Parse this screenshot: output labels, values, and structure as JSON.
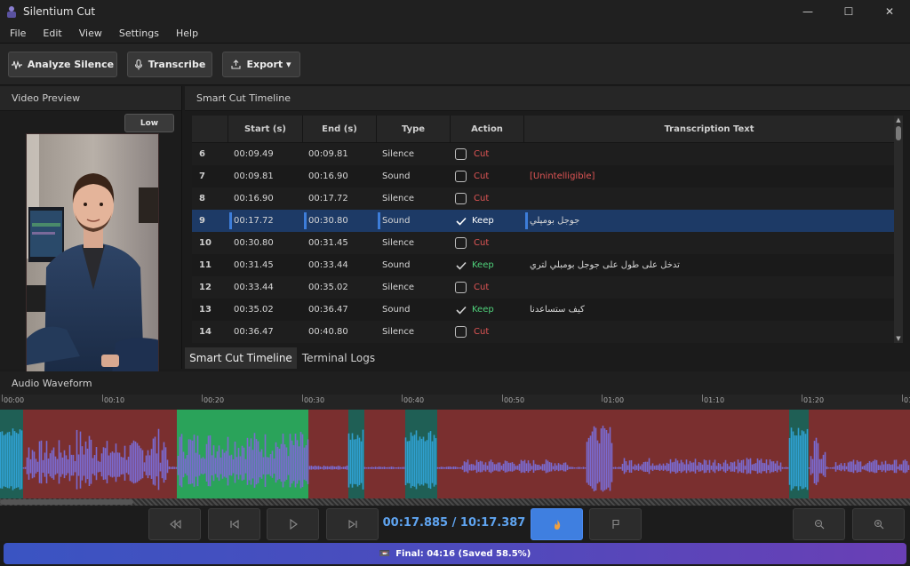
{
  "window": {
    "title": "Silentium Cut",
    "minimize_glyph": "—",
    "maximize_glyph": "☐",
    "close_glyph": "✕"
  },
  "menu": [
    "File",
    "Edit",
    "View",
    "Settings",
    "Help"
  ],
  "toolbar": {
    "analyze_label": "Analyze Silence",
    "transcribe_label": "Transcribe",
    "export_label": "Export ▾"
  },
  "video_preview": {
    "header": "Video Preview",
    "quality": "Low"
  },
  "timeline": {
    "header": "Smart Cut Timeline",
    "columns": [
      "Start (s)",
      "End (s)",
      "Type",
      "Action",
      "Transcription Text"
    ],
    "rows": [
      {
        "idx": "6",
        "start": "00:09.49",
        "end": "00:09.81",
        "type": "Silence",
        "action": "Cut",
        "checked": false,
        "text": "",
        "text_red": false,
        "selected": false
      },
      {
        "idx": "7",
        "start": "00:09.81",
        "end": "00:16.90",
        "type": "Sound",
        "action": "Cut",
        "checked": false,
        "text": "[Unintelligible]",
        "text_red": true,
        "selected": false
      },
      {
        "idx": "8",
        "start": "00:16.90",
        "end": "00:17.72",
        "type": "Silence",
        "action": "Cut",
        "checked": false,
        "text": "",
        "text_red": false,
        "selected": false
      },
      {
        "idx": "9",
        "start": "00:17.72",
        "end": "00:30.80",
        "type": "Sound",
        "action": "Keep",
        "checked": true,
        "text": "جوجل بومپلي",
        "text_red": false,
        "selected": true
      },
      {
        "idx": "10",
        "start": "00:30.80",
        "end": "00:31.45",
        "type": "Silence",
        "action": "Cut",
        "checked": false,
        "text": "",
        "text_red": false,
        "selected": false
      },
      {
        "idx": "11",
        "start": "00:31.45",
        "end": "00:33.44",
        "type": "Sound",
        "action": "Keep",
        "checked": true,
        "text": "تدخل على طول على جوجل بومبلي لتري",
        "text_red": false,
        "selected": false
      },
      {
        "idx": "12",
        "start": "00:33.44",
        "end": "00:35.02",
        "type": "Silence",
        "action": "Cut",
        "checked": false,
        "text": "",
        "text_red": false,
        "selected": false
      },
      {
        "idx": "13",
        "start": "00:35.02",
        "end": "00:36.47",
        "type": "Sound",
        "action": "Keep",
        "checked": true,
        "text": "كيف ستساعدنا",
        "text_red": false,
        "selected": false
      },
      {
        "idx": "14",
        "start": "00:36.47",
        "end": "00:40.80",
        "type": "Silence",
        "action": "Cut",
        "checked": false,
        "text": "",
        "text_red": false,
        "selected": false
      }
    ]
  },
  "tabs": [
    "Smart Cut Timeline",
    "Terminal Logs"
  ],
  "waveform": {
    "header": "Audio Waveform",
    "ticks": [
      "00:00",
      "00:10",
      "00:20",
      "00:30",
      "00:40",
      "00:50",
      "01:00",
      "01:10",
      "01:20",
      "01:3"
    ]
  },
  "transport": {
    "time": "00:17.885 / 10:17.387"
  },
  "status": {
    "icon": "📼",
    "text": "Final: 04:16 (Saved 58.5%)"
  },
  "colors": {
    "accent": "#3f7fe0",
    "cut": "#e05555",
    "keep": "#4fd07a",
    "waveform_cut_bg": "#7a2f2f",
    "waveform_keep_bg": "#1f8a4a",
    "waveform_sound_bg": "#1f5f55",
    "waveform_selected": "#2aa35a"
  }
}
